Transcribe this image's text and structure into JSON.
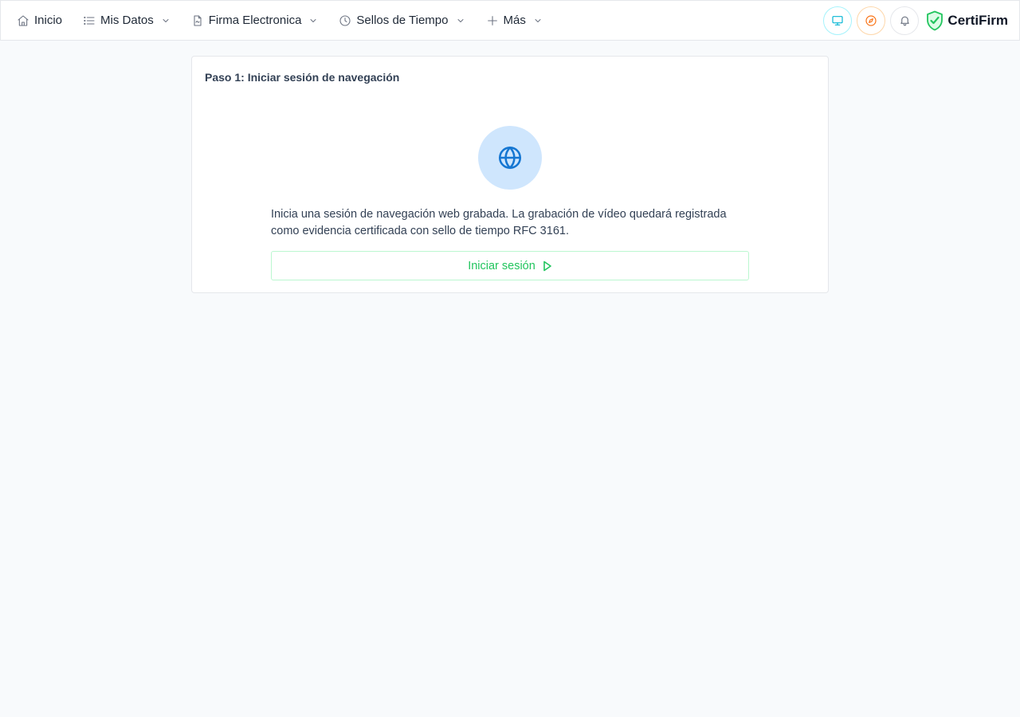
{
  "nav": {
    "items": [
      {
        "label": "Inicio",
        "icon": "home-icon",
        "dropdown": false
      },
      {
        "label": "Mis Datos",
        "icon": "list-icon",
        "dropdown": true
      },
      {
        "label": "Firma Electronica",
        "icon": "document-icon",
        "dropdown": true
      },
      {
        "label": "Sellos de Tiempo",
        "icon": "clock-icon",
        "dropdown": true
      },
      {
        "label": "Más",
        "icon": "plus-icon",
        "dropdown": true
      }
    ],
    "actions": [
      {
        "icon": "monitor-icon",
        "color": "#06b6d4"
      },
      {
        "icon": "compass-icon",
        "color": "#f97316"
      },
      {
        "icon": "bell-icon",
        "color": "#6b7280"
      }
    ],
    "brand": {
      "name": "CertiFirm",
      "logo_icon": "shield-check-icon",
      "color": "#22c55e"
    }
  },
  "card": {
    "title": "Paso 1: Iniciar sesión de navegación",
    "icon": "globe-icon",
    "description": "Inicia una sesión de navegación web grabada. La grabación de vídeo quedará registrada como evidencia certificada con sello de tiempo RFC 3161.",
    "button_label": "Iniciar sesión",
    "button_icon": "play-icon"
  },
  "colors": {
    "accent_green": "#22c55e",
    "globe_blue": "#1677d2",
    "globe_bg": "#cfe6fd",
    "page_bg": "#f8fafc"
  }
}
